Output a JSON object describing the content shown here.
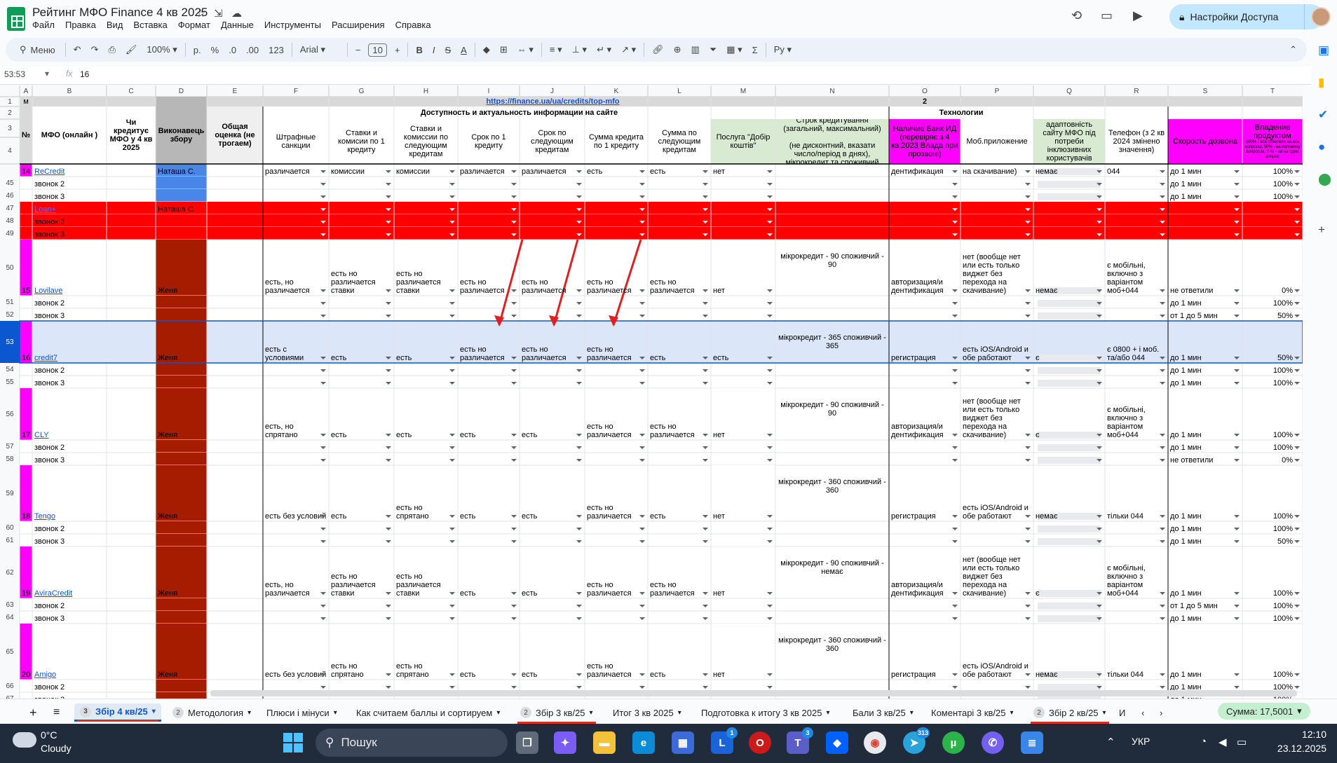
{
  "doc": {
    "title": "Рейтинг МФО Finance 4 кв 2025"
  },
  "menu": [
    "Файл",
    "Правка",
    "Вид",
    "Вставка",
    "Формат",
    "Данные",
    "Инструменты",
    "Расширения",
    "Справка"
  ],
  "share": {
    "label": "Настройки Доступа"
  },
  "toolbar": {
    "search_label": "Меню",
    "zoom": "100%",
    "currency": "р.",
    "percent": "%",
    "dec_minus": ".0",
    "dec_plus": ".00",
    "format123": "123",
    "font": "Arial",
    "font_size": "10",
    "bold": "B",
    "italic": "I",
    "strike": "S",
    "underline_a": "A"
  },
  "formula": {
    "namebox": "53:53",
    "fx": "fx",
    "value": "16"
  },
  "columns": [
    "A",
    "B",
    "C",
    "D",
    "E",
    "F",
    "G",
    "H",
    "I",
    "J",
    "K",
    "L",
    "M",
    "N",
    "O",
    "P",
    "Q",
    "R",
    "S",
    "T"
  ],
  "header": {
    "r1_m": "м",
    "r1_link": "https://finance.ua/ua/credits/top-mfo",
    "r1_num": "2",
    "r2_group1": "Доступность и актуальность информации на сайте",
    "r2_group2": "Технологии",
    "col_no": "№",
    "col_mfo": "МФО (онлайн )",
    "col_c": "Чи кредитує МФО у 4 кв 2025",
    "col_d": "Виконавець збору",
    "col_e": "Общая оценка (не трогаем)",
    "col_f": "Штрафные санкции",
    "col_g": "Ставки и комисии по 1 кредиту",
    "col_h": "Ставки и комиссии по следующим кредитам",
    "col_i": "Срок по 1 кредиту",
    "col_j": "Срок по следующим кредитам",
    "col_k": "Сумма кредита по 1 кредиту",
    "col_l": "Сумма по следующим кредитам",
    "col_m": "Послуга \"Добір коштів\"",
    "col_n": "Строк кредитування (загальний, максимальний)\n\n(не дисконтний, вказати число/період в днях), мікрокредит та споживчий",
    "col_o": "Наличие Банк ИД (перевіряє з 4 кв.2023 Влада при прозвоні)",
    "col_p": "Моб.приложение",
    "col_q": "адаптовність сайту МФО під потреби інклюзивних користувачів",
    "col_r": "Телефон (з 2 кв 2024 змінено значення)",
    "col_s": "Скорость дозвона",
    "col_t": "Владение продуктом",
    "col_t_small": "100% - все ответили на все вопросы, 50% - на половину вопросов, 0 % - ни на один вопрос"
  },
  "rows": [
    {
      "rn": "",
      "a": "14",
      "b": "ReCredit",
      "d": "Наташа С.",
      "f": "различается",
      "g": "комиссии",
      "h": "комиссии",
      "i": "различается",
      "j": "различается",
      "k": "есть",
      "l": "есть",
      "m": "нет",
      "n": "",
      "o": "дентификация",
      "p": "на скачивание)",
      "q": "немає",
      "r": "044",
      "s": "до 1 мин",
      "t": "100%"
    },
    {
      "rn": "45",
      "b": "звонок 2",
      "s": "до 1 мин",
      "t": "100%"
    },
    {
      "rn": "46",
      "b": "звонок 3",
      "s": "до 1 мин",
      "t": "100%"
    },
    {
      "rn": "47",
      "b": "Loan+",
      "d": "Наташа С."
    },
    {
      "rn": "48",
      "b": "звонок 2"
    },
    {
      "rn": "49",
      "b": "звонок 3"
    },
    {
      "rn": "50",
      "a": "15",
      "b": "Lovilave",
      "d": "Женя",
      "f": "есть, но различается",
      "g": "есть но различается ставки",
      "h": "есть но различается ставки",
      "i": "есть но различается",
      "j": "есть но различается",
      "k": "есть но различается",
      "l": "есть но различается",
      "m": "нет",
      "n": "мікрокредит - 90 споживчий - 90",
      "o": "авторизация/и дентификация",
      "p": "нет (вообще нет или есть только виджет без перехода на скачивание)",
      "q": "немає",
      "r": "є мобільні, включно з варіантом моб+044",
      "s": "не ответили",
      "t": "0%"
    },
    {
      "rn": "51",
      "b": "звонок 2",
      "s": "до 1 мин",
      "t": "100%"
    },
    {
      "rn": "52",
      "b": "звонок 3",
      "s": "от 1 до 5 мин",
      "t": "50%"
    },
    {
      "rn": "53",
      "a": "16",
      "b": "credit7",
      "d": "Женя",
      "f": "есть с условиями",
      "g": "есть",
      "h": "есть",
      "i": "есть но различается",
      "j": "есть но различается",
      "k": "есть но различается",
      "l": "есть",
      "m": "есть",
      "n": "мікрокредит - 365 споживчий - 365",
      "o": "регистрация",
      "p": "есть iOS/Android и обе работают",
      "q": "є",
      "r": "є 0800 + і моб. та/або 044",
      "s": "до 1 мин",
      "t": "50%"
    },
    {
      "rn": "54",
      "b": "звонок 2",
      "s": "до 1 мин",
      "t": "100%"
    },
    {
      "rn": "55",
      "b": "звонок 3",
      "s": "до 1 мин",
      "t": "100%"
    },
    {
      "rn": "56",
      "a": "17",
      "b": "CLY",
      "d": "Женя",
      "f": "есть, но спрятано",
      "g": "есть",
      "h": "есть",
      "i": "есть",
      "j": "есть",
      "k": "есть но различается",
      "l": "есть но различается",
      "m": "нет",
      "n": "мікрокредит - 90 споживчий - 90",
      "o": "авторизация/и дентификация",
      "p": "нет (вообще нет или есть только виджет без перехода на скачивание)",
      "q": "є",
      "r": "є мобільні, включно з варіантом моб+044",
      "s": "до 1 мин",
      "t": "100%"
    },
    {
      "rn": "57",
      "b": "звонок 2",
      "s": "до 1 мин",
      "t": "100%"
    },
    {
      "rn": "58",
      "b": "звонок 3",
      "s": "не ответили",
      "t": "0%"
    },
    {
      "rn": "59",
      "a": "18",
      "b": "Tengo",
      "d": "Женя",
      "f": "есть без условий",
      "g": "есть",
      "h": "есть но спрятано",
      "i": "есть",
      "j": "есть",
      "k": "есть но различается",
      "l": "есть",
      "m": "нет",
      "n": "мікрокредит - 360 споживчий - 360",
      "o": "регистрация",
      "p": "есть iOS/Android и обе работают",
      "q": "немає",
      "r": "тільки 044",
      "s": "до 1 мин",
      "t": "100%"
    },
    {
      "rn": "60",
      "b": "звонок 2",
      "s": "до 1 мин",
      "t": "100%"
    },
    {
      "rn": "61",
      "b": "звонок 3",
      "s": "до 1 мин",
      "t": "50%"
    },
    {
      "rn": "62",
      "a": "19",
      "b": "AviraCredit",
      "d": "Женя",
      "f": "есть, но различается",
      "g": "есть но различается ставки",
      "h": "есть но различается ставки",
      "i": "есть",
      "j": "есть",
      "k": "есть но различается",
      "l": "есть но различается",
      "m": "нет",
      "n": "мікрокредит - 90 споживчий - немає",
      "o": "авторизация/и дентификация",
      "p": "нет (вообще нет или есть только виджет без перехода на скачивание)",
      "q": "є",
      "r": "є мобільні, включно з варіантом моб+044",
      "s": "до 1 мин",
      "t": "100%"
    },
    {
      "rn": "63",
      "b": "звонок 2",
      "s": "от 1 до 5 мин",
      "t": "100%"
    },
    {
      "rn": "64",
      "b": "звонок 3",
      "s": "до 1 мин",
      "t": "100%"
    },
    {
      "rn": "65",
      "a": "20",
      "b": "Amigo",
      "d": "Женя",
      "f": "есть без условий",
      "g": "есть но спрятано",
      "h": "есть но спрятано",
      "i": "есть",
      "j": "есть",
      "k": "есть но различается",
      "l": "есть",
      "m": "нет",
      "n": "мікрокредит - 360 споживчий - 360",
      "o": "регистрация",
      "p": "есть iOS/Android и обе работают",
      "q": "немає",
      "r": "тільки 044",
      "s": "до 1 мин",
      "t": "100%"
    },
    {
      "rn": "66",
      "b": "звонок 2",
      "s": "до 1 мин",
      "t": "100%"
    },
    {
      "rn": "67",
      "b": "звонок 3",
      "s": "до 1 мин",
      "t": "100%"
    }
  ],
  "tabs": [
    {
      "num": "3",
      "label": "Збір 4 кв/25",
      "active": true
    },
    {
      "num": "2",
      "label": "Методология"
    },
    {
      "num": "",
      "label": "Плюси і мінуси"
    },
    {
      "num": "",
      "label": "Как считаем баллы и сортируем"
    },
    {
      "num": "2",
      "label": "Збір 3 кв/25"
    },
    {
      "num": "",
      "label": "Итог 3 кв 2025"
    },
    {
      "num": "",
      "label": "Подготовка к итогу 3 кв  2025"
    },
    {
      "num": "",
      "label": "Бали 3 кв/25"
    },
    {
      "num": "",
      "label": "Коментарі 3 кв/25"
    },
    {
      "num": "2",
      "label": "Збір 2 кв/25"
    },
    {
      "num": "",
      "label": "И"
    }
  ],
  "sum": {
    "label": "Сумма: 17,5001"
  },
  "taskbar": {
    "temp": "0°C",
    "cond": "Cloudy",
    "search": "Пошук",
    "lang": "УКР",
    "time": "12:10",
    "date": "23.12.2025",
    "badges": {
      "l": "1",
      "teams": "3",
      "telegram": "313"
    }
  },
  "colors": {
    "magenta": "#ff00ff",
    "red": "#ff0000",
    "dark_red": "#a61c00",
    "blue": "#4a86e8",
    "green_light": "#d9ead3",
    "grey": "#efefef",
    "selection": "#dbe7f8",
    "accent": "#0b57d0"
  }
}
